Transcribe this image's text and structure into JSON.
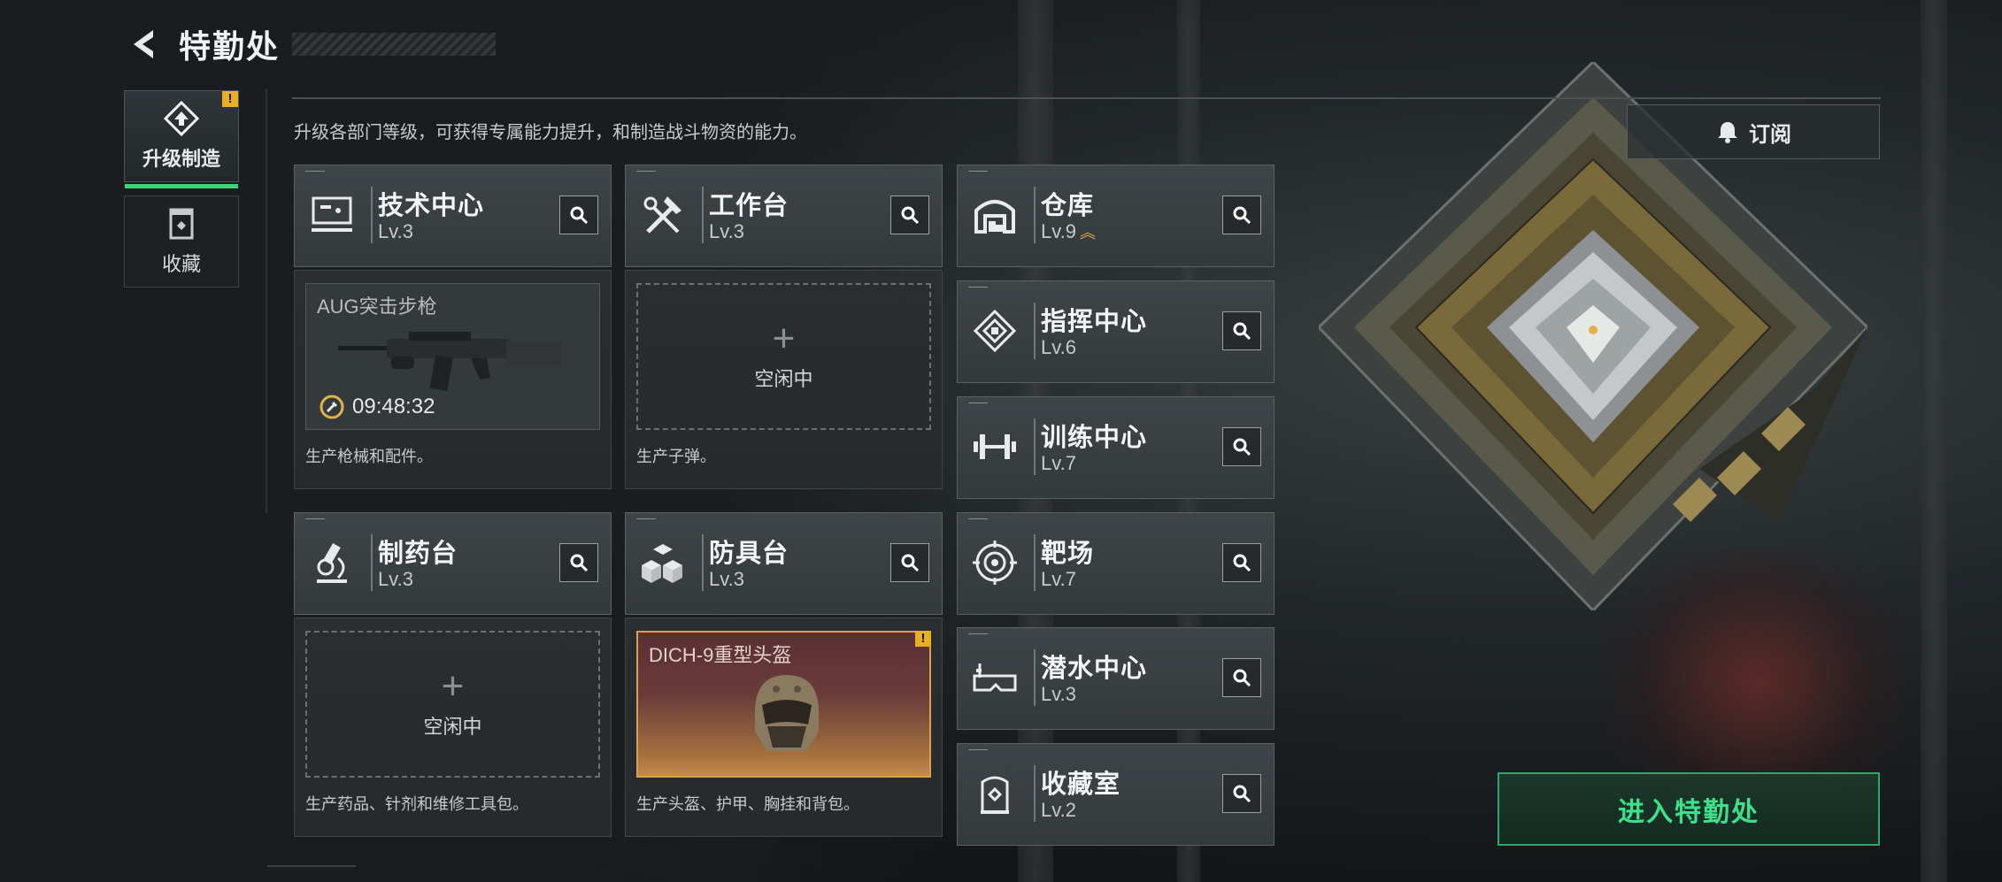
{
  "header": {
    "title": "特勤处"
  },
  "side_tabs": [
    {
      "label": "升级制造",
      "active": true,
      "badge": "!"
    },
    {
      "label": "收藏",
      "active": false
    }
  ],
  "description": "升级各部门等级，可获得专属能力提升，和制造战斗物资的能力。",
  "subscribe_label": "订阅",
  "enter_button": "进入特勤处",
  "facilities": {
    "tech_center": {
      "name": "技术中心",
      "level": "Lv.3"
    },
    "workbench": {
      "name": "工作台",
      "level": "Lv.3"
    },
    "warehouse": {
      "name": "仓库",
      "level": "Lv.9",
      "upgradable": true
    },
    "command_center": {
      "name": "指挥中心",
      "level": "Lv.6"
    },
    "training_center": {
      "name": "训练中心",
      "level": "Lv.7"
    },
    "pharmacy": {
      "name": "制药台",
      "level": "Lv.3"
    },
    "armor_bench": {
      "name": "防具台",
      "level": "Lv.3"
    },
    "shooting_range": {
      "name": "靶场",
      "level": "Lv.7"
    },
    "diving_center": {
      "name": "潜水中心",
      "level": "Lv.3"
    },
    "collection_room": {
      "name": "收藏室",
      "level": "Lv.2"
    }
  },
  "production": {
    "tech_center": {
      "item": "AUG突击步枪",
      "timer": "09:48:32",
      "desc": "生产枪械和配件。"
    },
    "workbench": {
      "status": "空闲中",
      "desc": "生产子弹。"
    },
    "pharmacy": {
      "status": "空闲中",
      "desc": "生产药品、针剂和维修工具包。"
    },
    "armor_bench": {
      "item": "DICH-9重型头盔",
      "badge": "!",
      "desc": "生产头盔、护甲、胸挂和背包。"
    }
  },
  "colors": {
    "accent_green": "#3fd277",
    "warning": "#e8b020",
    "enter_text": "#3fe08a"
  }
}
